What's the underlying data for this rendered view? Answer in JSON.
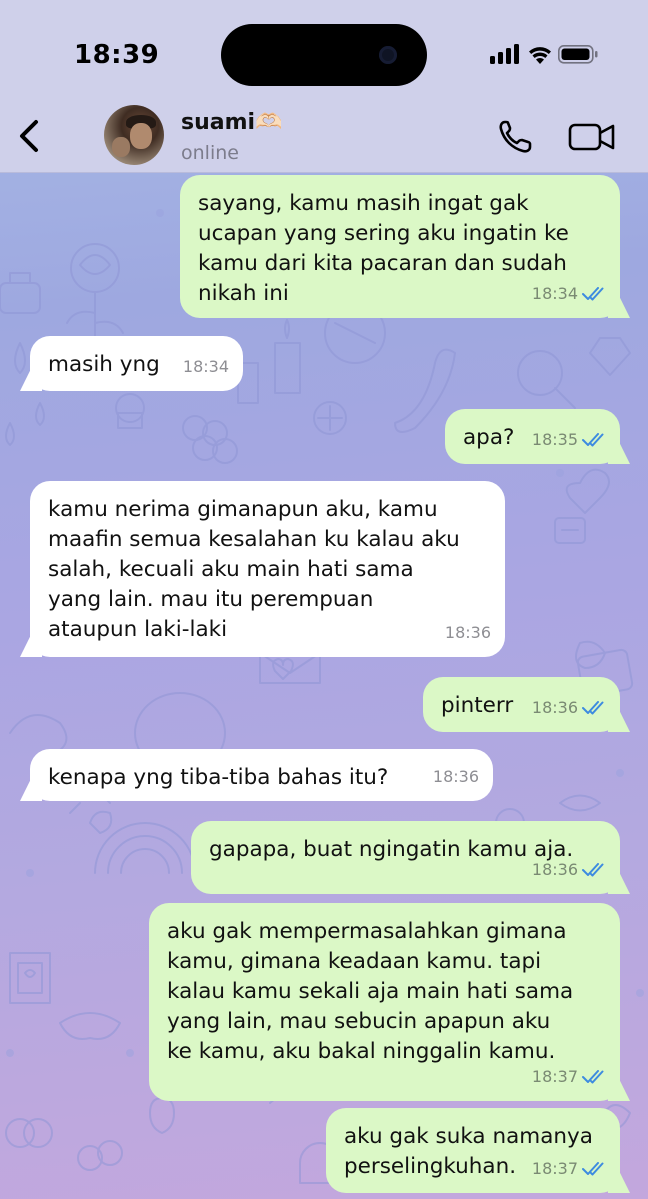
{
  "status_bar": {
    "time": "18:39"
  },
  "header": {
    "contact_name": "suami🫶🏻",
    "contact_status": "online"
  },
  "colors": {
    "outgoing_bubble": "#dbf8c6",
    "incoming_bubble": "#ffffff",
    "read_ticks": "#3d8be0"
  },
  "messages": [
    {
      "dir": "out",
      "text": "sayang, kamu masih ingat gak\nucapan yang sering aku ingatin ke\nkamu dari kita pacaran dan sudah\nnikah ini",
      "time": "18:34",
      "read": true
    },
    {
      "dir": "in",
      "text": "masih yng",
      "time": "18:34"
    },
    {
      "dir": "out",
      "text": "apa?",
      "time": "18:35",
      "read": true
    },
    {
      "dir": "in",
      "text": "kamu nerima gimanapun aku, kamu\nmaafin semua kesalahan ku kalau aku\nsalah, kecuali aku main hati sama\nyang lain. mau itu perempuan\nataupun laki-laki",
      "time": "18:36"
    },
    {
      "dir": "out",
      "text": "pinterr",
      "time": "18:36",
      "read": true
    },
    {
      "dir": "in",
      "text": "kenapa yng tiba-tiba bahas itu?",
      "time": "18:36"
    },
    {
      "dir": "out",
      "text": "gapapa, buat ngingatin kamu aja.",
      "time": "18:36",
      "read": true
    },
    {
      "dir": "out",
      "text": "aku gak mempermasalahkan gimana\nkamu, gimana keadaan kamu. tapi\nkalau kamu sekali aja main hati sama\nyang lain, mau sebucin apapun aku\nke kamu, aku bakal ninggalin kamu.",
      "time": "18:37",
      "read": true
    },
    {
      "dir": "out",
      "text": "aku gak suka namanya\nperselingkuhan.",
      "time": "18:37",
      "read": true
    }
  ]
}
